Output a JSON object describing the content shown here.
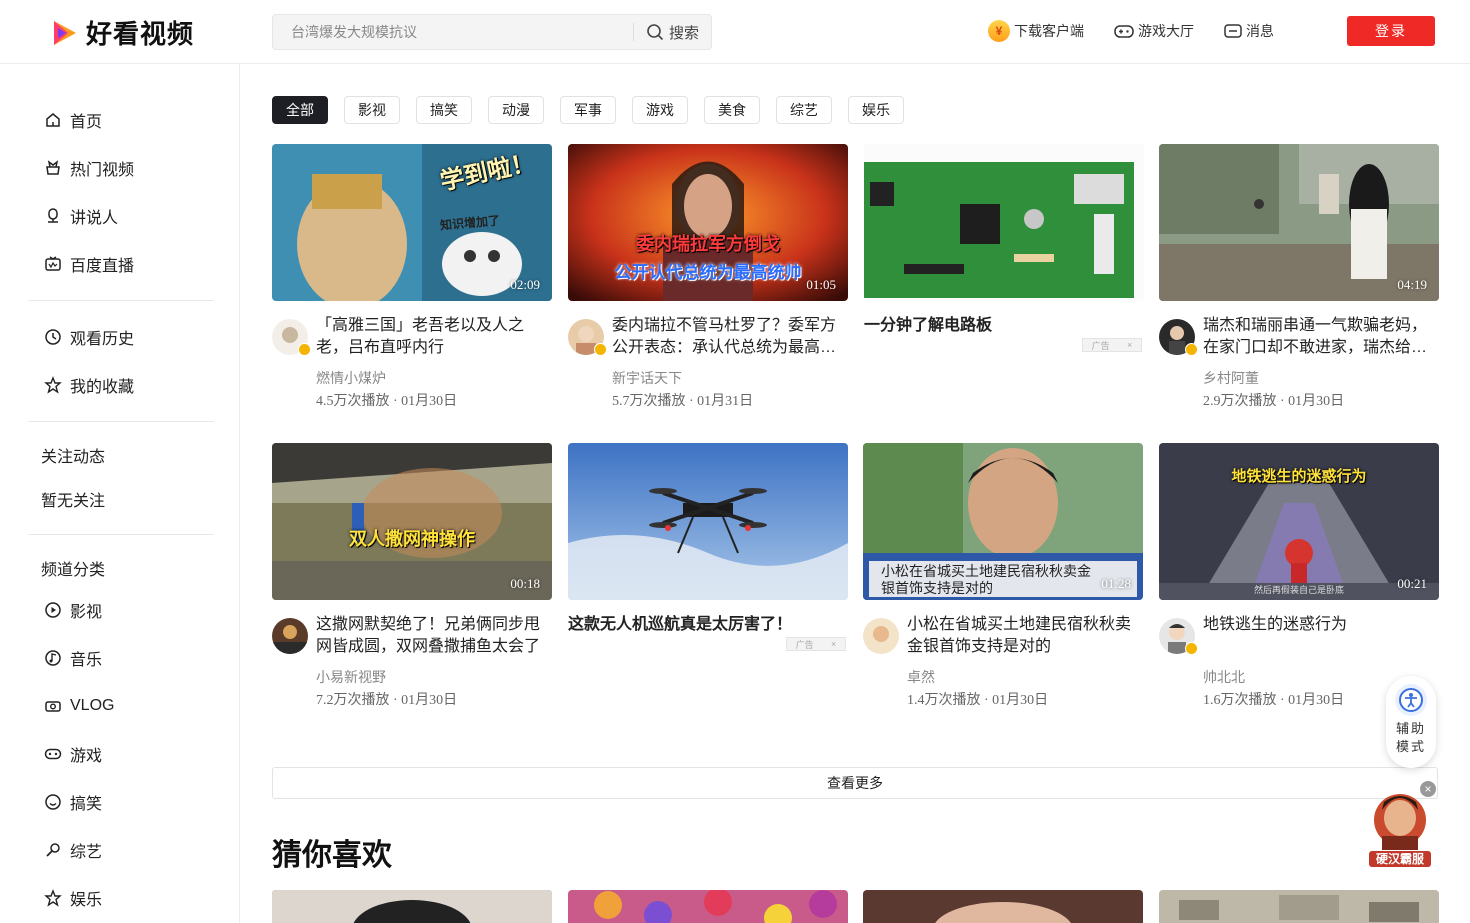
{
  "header": {
    "logo_text": "好看视频",
    "search_placeholder": "台湾爆发大规模抗议",
    "search_button": "搜索",
    "download": "下载客户端",
    "coin_glyph": "¥",
    "game_hall": "游戏大厅",
    "messages": "消息",
    "login": "登录"
  },
  "sidebar": {
    "primary": [
      "首页",
      "热门视频",
      "讲说人",
      "百度直播"
    ],
    "personal": [
      "观看历史",
      "我的收藏"
    ],
    "follow_title": "关注动态",
    "follow_empty": "暂无关注",
    "channel_title": "频道分类",
    "channels": [
      "影视",
      "音乐",
      "VLOG",
      "游戏",
      "搞笑",
      "综艺",
      "娱乐"
    ]
  },
  "chips": [
    "全部",
    "影视",
    "搞笑",
    "动漫",
    "军事",
    "游戏",
    "美食",
    "综艺",
    "娱乐"
  ],
  "videos": [
    {
      "title": "「高雅三国」老吾老以及人之老，吕布直呼内行",
      "author": "燃情小煤炉",
      "meta": "4.5万次播放 · 01月30日",
      "duration": "02:09",
      "overlay": "学到啦！",
      "overlay2": "知识增加了"
    },
    {
      "title": "委内瑞拉不管马杜罗了？委军方公开表态：承认代总统为最高统帅",
      "author": "新宇话天下",
      "meta": "5.7万次播放 · 01月31日",
      "duration": "01:05",
      "overlay": "委内瑞拉军方倒戈",
      "overlay2": "公开认代总统为最高统帅"
    },
    {
      "title": "一分钟了解电路板",
      "ad": true,
      "ad_label": "广告"
    },
    {
      "title": "瑞杰和瑞丽串通一气欺骗老妈，在家门口却不敢进家，瑞杰给老妈道歉",
      "author": "乡村阿董",
      "meta": "2.9万次播放 · 01月30日",
      "duration": "04:19"
    },
    {
      "title": "这撒网默契绝了！兄弟俩同步甩网皆成圆，双网叠撒捕鱼太会了",
      "author": "小易新视野",
      "meta": "7.2万次播放 · 01月30日",
      "duration": "00:18",
      "overlay": "双人撒网神操作"
    },
    {
      "title": "这款无人机巡航真是太厉害了！",
      "ad": true,
      "ad_label": "广告"
    },
    {
      "title": "小松在省城买土地建民宿秋秋卖金银首饰支持是对的",
      "author": "卓然",
      "meta": "1.4万次播放 · 01月30日",
      "duration": "01:28",
      "overlay": "小松在省城买土地建民宿秋秋卖金",
      "overlay2": "银首饰支持是对的"
    },
    {
      "title": "地铁逃生的迷惑行为",
      "author": "帅北北",
      "meta": "1.6万次播放 · 01月30日",
      "duration": "00:21",
      "overlay": "地铁逃生的迷惑行为",
      "overlay2": "然后再假装自己是卧底"
    }
  ],
  "more_label": "查看更多",
  "section_title": "猜你喜欢",
  "assist_label": [
    "辅助",
    "模式"
  ],
  "game_ad_label": "硬汉霸服",
  "game_close": "×",
  "ad_close": "×",
  "colors": {
    "accent": "#ef2a26",
    "chip_active": "#1e1f24"
  }
}
